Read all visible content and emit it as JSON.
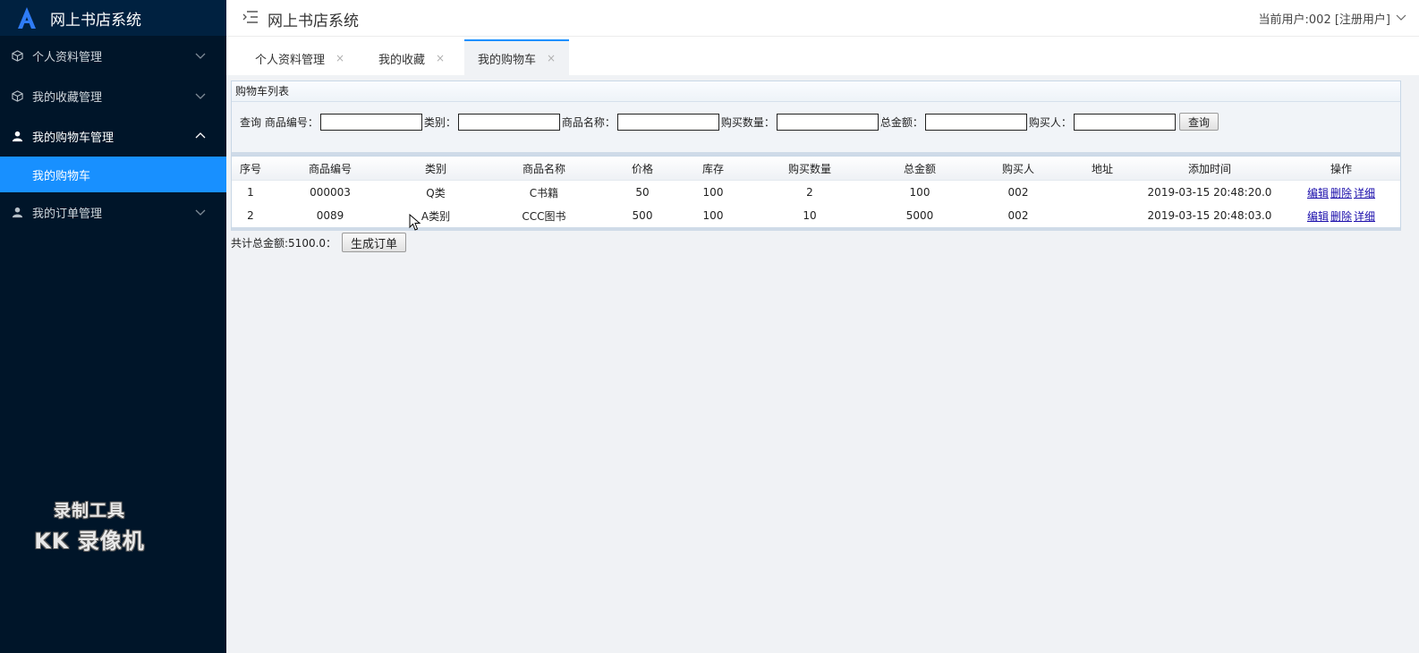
{
  "app": {
    "title": "网上书店系统"
  },
  "header": {
    "title": "网上书店系统",
    "user": "当前用户:002 [注册用户]"
  },
  "sidebar": {
    "items": [
      {
        "label": "个人资料管理",
        "icon": "cube-icon",
        "expanded": false
      },
      {
        "label": "我的收藏管理",
        "icon": "cube-icon",
        "expanded": false
      },
      {
        "label": "我的购物车管理",
        "icon": "user-icon",
        "expanded": true,
        "children": [
          {
            "label": "我的购物车",
            "active": true
          }
        ]
      },
      {
        "label": "我的订单管理",
        "icon": "user-icon",
        "expanded": false
      }
    ]
  },
  "tabs": [
    {
      "label": "个人资料管理",
      "close": "×"
    },
    {
      "label": "我的收藏",
      "close": "×"
    },
    {
      "label": "我的购物车",
      "close": "×",
      "active": true
    }
  ],
  "panel": {
    "title": "购物车列表"
  },
  "search": {
    "query_label": "查询",
    "fields": [
      {
        "label": "商品编号：",
        "value": ""
      },
      {
        "label": "类别：",
        "value": ""
      },
      {
        "label": "商品名称：",
        "value": ""
      },
      {
        "label": "购买数量：",
        "value": ""
      },
      {
        "label": "总金额：",
        "value": ""
      },
      {
        "label": "购买人：",
        "value": ""
      }
    ],
    "button": "查询"
  },
  "table": {
    "columns": [
      "序号",
      "商品编号",
      "类别",
      "商品名称",
      "价格",
      "库存",
      "购买数量",
      "总金额",
      "购买人",
      "地址",
      "添加时间",
      "操作"
    ],
    "rows": [
      [
        "1",
        "000003",
        "Q类",
        "C书籍",
        "50",
        "100",
        "2",
        "100",
        "002",
        "",
        "2019-03-15 20:48:20.0"
      ],
      [
        "2",
        "0089",
        "A类别",
        "CCC图书",
        "500",
        "100",
        "10",
        "5000",
        "002",
        "",
        "2019-03-15 20:48:03.0"
      ]
    ],
    "actions": [
      "编辑",
      "删除",
      "详细"
    ]
  },
  "footer": {
    "total_text": "共计总金额:5100.0：",
    "button": "生成订单"
  },
  "watermark": {
    "line1": "录制工具",
    "line2": "KK 录像机"
  },
  "colors": {
    "sidebar_bg": "#001529",
    "accent": "#1890ff"
  }
}
